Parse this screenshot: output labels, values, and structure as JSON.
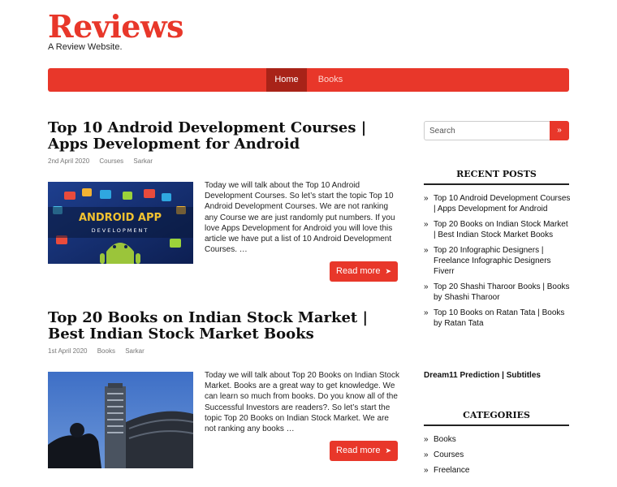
{
  "site": {
    "title": "Reviews",
    "description": "A Review Website."
  },
  "nav": {
    "items": [
      {
        "label": "Home"
      },
      {
        "label": "Books"
      }
    ]
  },
  "posts": [
    {
      "title": "Top 10 Android Development Courses | Apps Development for Android",
      "date": "2nd April 2020",
      "category": "Courses",
      "author": "Sarkar",
      "thumb_text_1": "ANDROID APP",
      "thumb_text_2": "DEVELOPMENT",
      "excerpt": "Today we will talk about the Top 10 Android Development Courses. So let’s start the topic Top 10 Android Development Courses. We are not ranking any Course we are just randomly put numbers. If you love Apps Development for Android you will love this article we have put a list of 10 Android Development Courses. …",
      "read_more": "Read more"
    },
    {
      "title": "Top 20 Books on Indian Stock Market | Best Indian Stock Market Books",
      "date": "1st April 2020",
      "category": "Books",
      "author": "Sarkar",
      "excerpt": "Today we will talk about Top 20 Books on Indian Stock Market. Books are a great way to get knowledge. We can learn so much from books. Do you know all of the Successful Investors are readers?. So let’s start the topic Top 20 Books on Indian Stock Market. We are not ranking any books …",
      "read_more": "Read more"
    }
  ],
  "sidebar": {
    "search_placeholder": "Search",
    "search_button": "»",
    "recent_title": "RECENT POSTS",
    "recent_posts": [
      "Top 10 Android Development Courses | Apps Development for Android",
      "Top 20 Books on Indian Stock Market | Best Indian Stock Market Books",
      "Top 20 Infographic Designers | Freelance Infographic Designers Fiverr",
      "Top 20 Shashi Tharoor Books | Books by Shashi Tharoor",
      "Top 10 Books on Ratan Tata | Books by Ratan Tata"
    ],
    "dream_text": "Dream11 Prediction | Subtitles",
    "categories_title": "CATEGORIES",
    "categories": [
      "Books",
      "Courses",
      "Freelance"
    ],
    "bullet": "»"
  },
  "colors": {
    "accent": "#e8372a",
    "nav_active": "#a82318",
    "text": "#222222"
  }
}
